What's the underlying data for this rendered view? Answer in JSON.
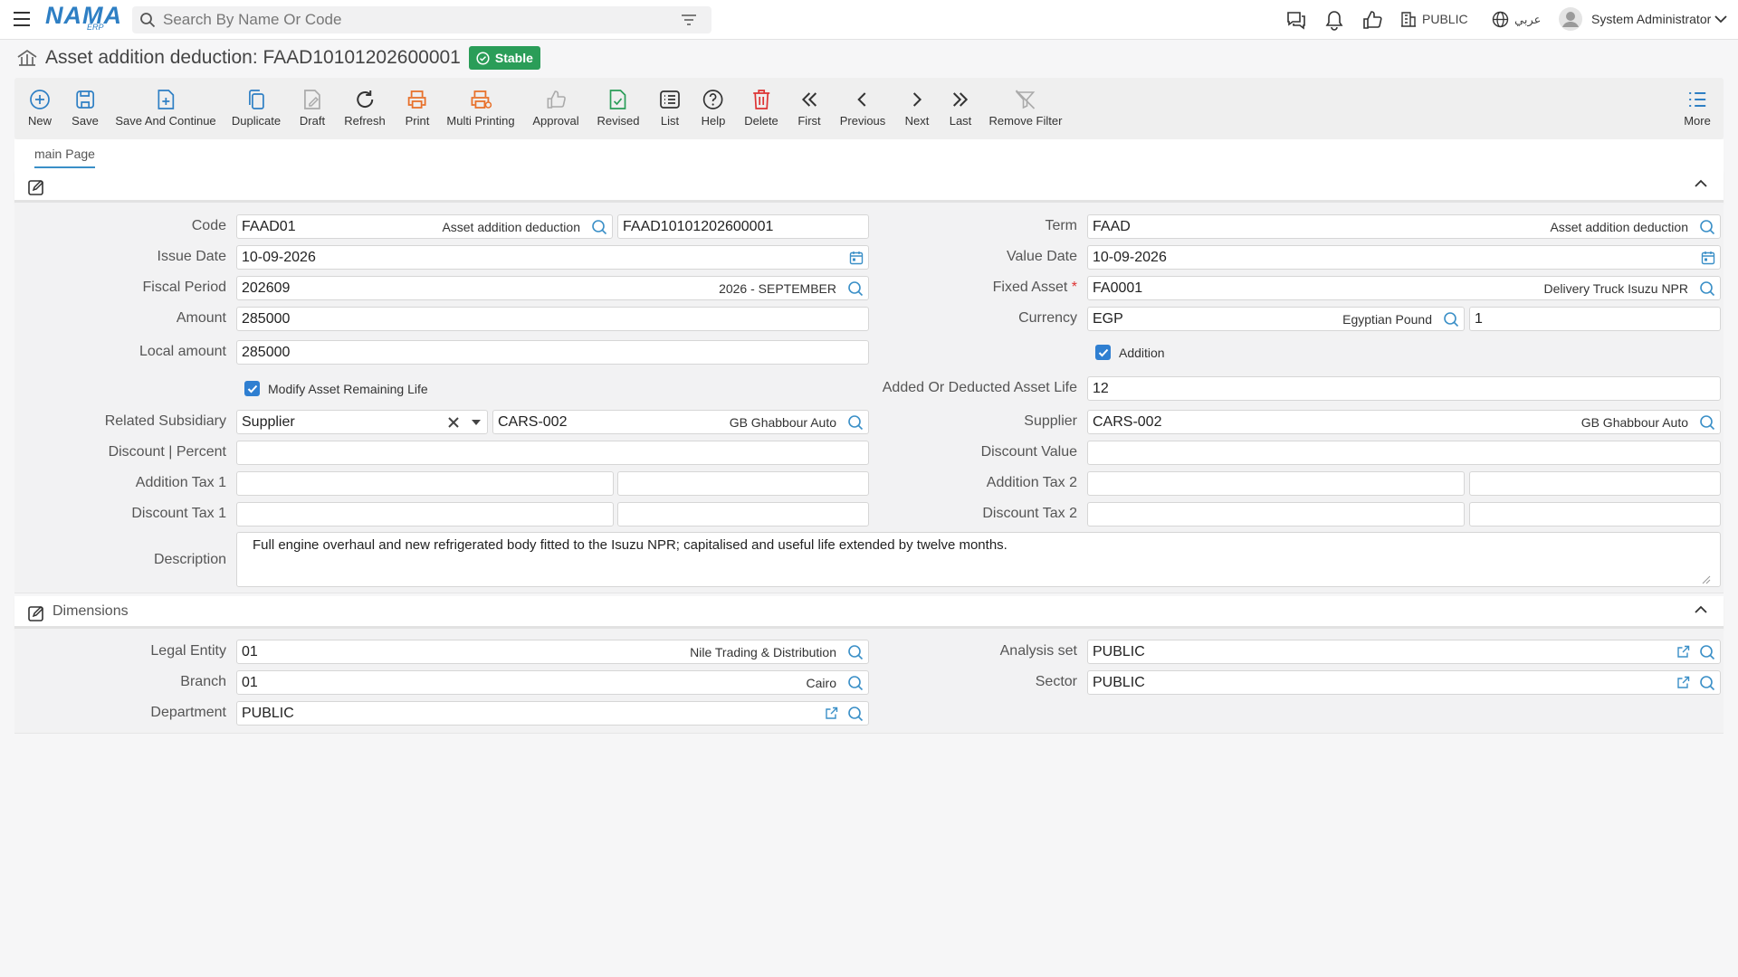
{
  "header": {
    "logo": "NAMA",
    "logo_sub": "ERP",
    "search_placeholder": "Search By Name Or Code",
    "public_label": "PUBLIC",
    "language_label": "عربي",
    "user_name": "System Administrator"
  },
  "page": {
    "title": "Asset addition deduction: FAAD10101202600001",
    "status": "Stable"
  },
  "toolbar": {
    "new": "New",
    "save": "Save",
    "save_continue": "Save And Continue",
    "duplicate": "Duplicate",
    "draft": "Draft",
    "refresh": "Refresh",
    "print": "Print",
    "multi_printing": "Multi Printing",
    "approval": "Approval",
    "revised": "Revised",
    "list": "List",
    "help": "Help",
    "delete": "Delete",
    "first": "First",
    "previous": "Previous",
    "next": "Next",
    "last": "Last",
    "remove_filter": "Remove Filter",
    "more": "More"
  },
  "tabs": {
    "main": "main Page"
  },
  "form": {
    "code": {
      "label": "Code",
      "value": "FAAD01",
      "desc": "Asset addition deduction",
      "number": "FAAD10101202600001"
    },
    "term": {
      "label": "Term",
      "value": "FAAD",
      "desc": "Asset addition deduction"
    },
    "issue_date": {
      "label": "Issue Date",
      "value": "10-09-2026"
    },
    "value_date": {
      "label": "Value Date",
      "value": "10-09-2026"
    },
    "fiscal_period": {
      "label": "Fiscal Period",
      "value": "202609",
      "desc": "2026 - SEPTEMBER"
    },
    "fixed_asset": {
      "label": "Fixed Asset",
      "required": "*",
      "value": "FA0001",
      "desc": "Delivery Truck Isuzu NPR"
    },
    "amount": {
      "label": "Amount",
      "value": "285000"
    },
    "currency": {
      "label": "Currency",
      "value": "EGP",
      "desc": "Egyptian Pound",
      "rate": "1"
    },
    "local_amount": {
      "label": "Local amount",
      "value": "285000"
    },
    "addition": {
      "label": "Addition",
      "checked": true
    },
    "modify_life": {
      "label": "Modify Asset Remaining Life",
      "checked": true
    },
    "added_life": {
      "label": "Added Or Deducted Asset Life",
      "value": "12"
    },
    "related_subsidiary": {
      "label": "Related Subsidiary",
      "type": "Supplier",
      "code": "CARS-002",
      "desc": "GB Ghabbour Auto"
    },
    "supplier": {
      "label": "Supplier",
      "value": "CARS-002",
      "desc": "GB Ghabbour Auto"
    },
    "discount_percent": {
      "label": "Discount | Percent",
      "value": ""
    },
    "discount_value": {
      "label": "Discount Value",
      "value": ""
    },
    "addition_tax1": {
      "label": "Addition Tax 1"
    },
    "addition_tax2": {
      "label": "Addition Tax 2"
    },
    "discount_tax1": {
      "label": "Discount Tax 1"
    },
    "discount_tax2": {
      "label": "Discount Tax 2"
    },
    "description": {
      "label": "Description",
      "value": "Full engine overhaul and new refrigerated body fitted to the Isuzu NPR; capitalised and useful life extended by twelve months."
    }
  },
  "dimensions": {
    "title": "Dimensions",
    "legal_entity": {
      "label": "Legal Entity",
      "value": "01",
      "desc": "Nile Trading & Distribution"
    },
    "analysis_set": {
      "label": "Analysis set",
      "value": "PUBLIC"
    },
    "branch": {
      "label": "Branch",
      "value": "01",
      "desc": "Cairo"
    },
    "sector": {
      "label": "Sector",
      "value": "PUBLIC"
    },
    "department": {
      "label": "Department",
      "value": "PUBLIC"
    }
  },
  "colors": {
    "accent": "#3a8fc7",
    "badge": "#2a9d58",
    "print": "#e8702a",
    "checkbox": "#2f7fd1"
  }
}
